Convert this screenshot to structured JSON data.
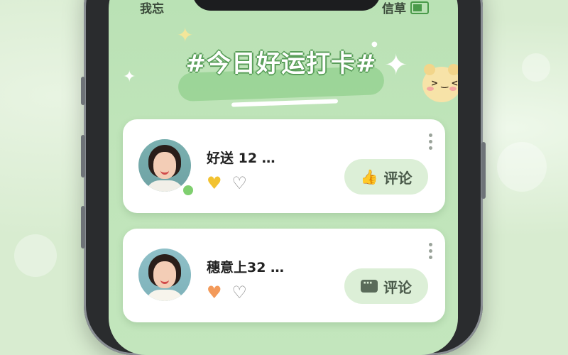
{
  "status_bar": {
    "left_text": "我忘",
    "right_text": "信草"
  },
  "page": {
    "title": "#今日好运打卡#"
  },
  "posts": [
    {
      "username": "好送 12 …",
      "heart1": "yellow-heart",
      "heart2": "outline-heart",
      "action_icon": "thumbs-up-icon",
      "action_label": "评论"
    },
    {
      "username": "穗意上32 …",
      "heart1": "orange-heart",
      "heart2": "outline-heart",
      "action_icon": "chat-bubble-icon",
      "action_label": "评论"
    }
  ],
  "colors": {
    "background": "#d8ecd0",
    "screen": "#bfe4b9",
    "accent": "#8fce8a",
    "yellow_heart": "#f2c230",
    "orange_heart": "#f39a5a"
  }
}
